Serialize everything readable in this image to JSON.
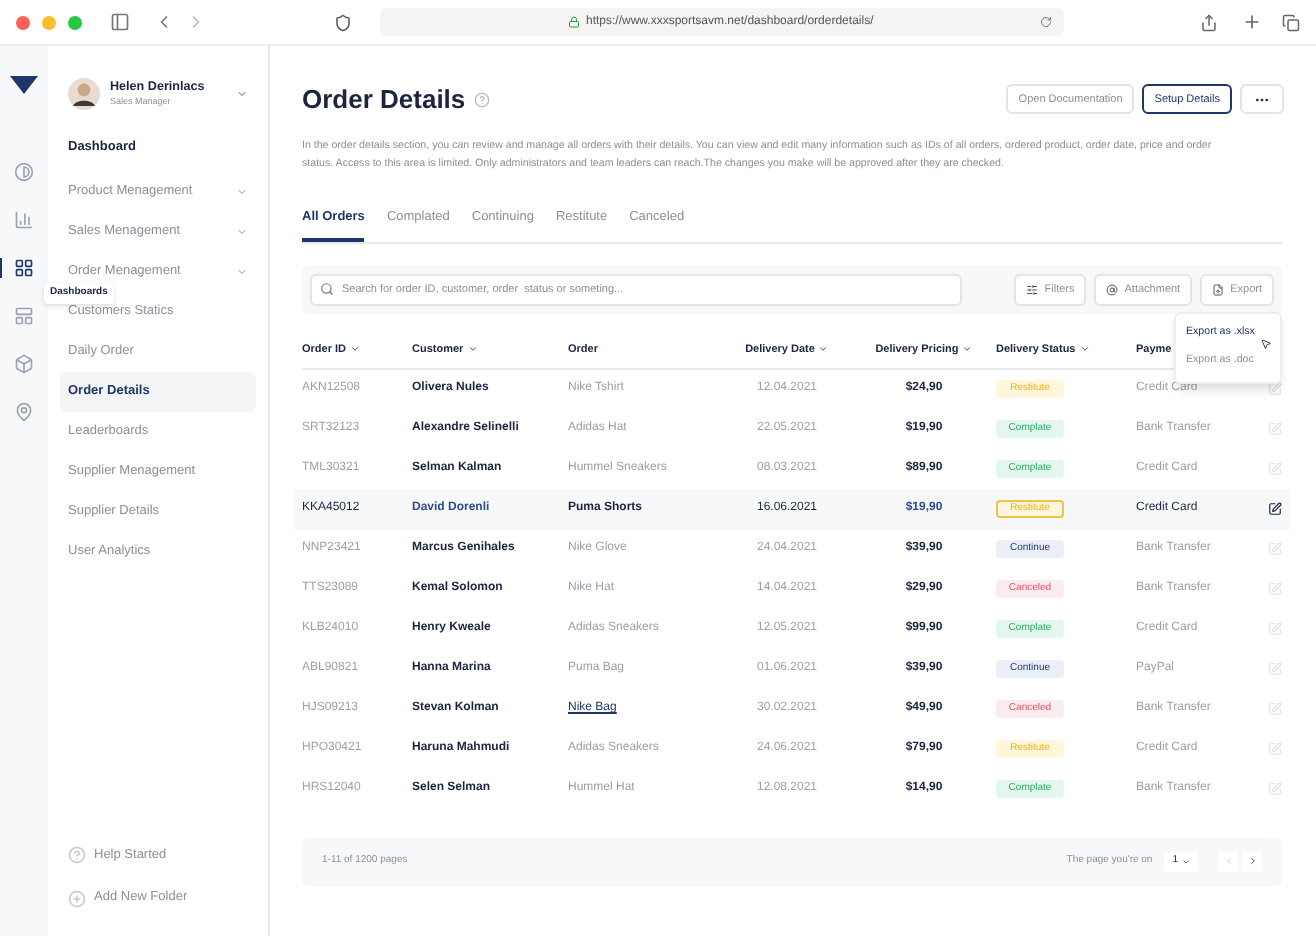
{
  "browser": {
    "url": "https://www.xxxsportsavm.net/dashboard/orderdetails/"
  },
  "rail": [
    {
      "selected": false
    },
    {
      "selected": false
    },
    {
      "selected": true
    },
    {
      "selected": false
    },
    {
      "selected": false
    },
    {
      "selected": false
    }
  ],
  "tooltip": "Dashboards",
  "profile": {
    "name": "Helen Derinlacs",
    "role": "Sales Manager"
  },
  "sidebar": {
    "heading": "Dashboard",
    "items": [
      {
        "label": "Product Menagement",
        "expandable": true,
        "selected": false
      },
      {
        "label": "Sales Menagement",
        "expandable": true,
        "selected": false
      },
      {
        "label": "Order Menagement",
        "expandable": true,
        "selected": false
      },
      {
        "label": "Customers Statics",
        "expandable": false,
        "selected": false
      },
      {
        "label": "Daily Order",
        "expandable": false,
        "selected": false
      },
      {
        "label": "Order Details",
        "expandable": false,
        "selected": true
      },
      {
        "label": "Leaderboards",
        "expandable": false,
        "selected": false
      },
      {
        "label": "Supplier Menagement",
        "expandable": false,
        "selected": false
      },
      {
        "label": "Supplier Details",
        "expandable": false,
        "selected": false
      },
      {
        "label": "User Analytics",
        "expandable": false,
        "selected": false
      }
    ],
    "footer": [
      {
        "label": "Help Started"
      },
      {
        "label": "Add New Folder"
      }
    ]
  },
  "page": {
    "title": "Order Details",
    "buttons": [
      {
        "label": "Open Documentation",
        "selected": false
      },
      {
        "label": "Setup Details",
        "selected": true
      }
    ],
    "description": "In the order details section, you can review and manage all orders with their details. You can view and edit many information such as IDs of all orders, ordered product, order date, price and order status. Access to this area is limited. Only administrators and team leaders can reach.The changes you make will be approved after they are checked."
  },
  "tabs": [
    {
      "label": "All Orders",
      "selected": true
    },
    {
      "label": "Complated",
      "selected": false
    },
    {
      "label": "Continuing",
      "selected": false
    },
    {
      "label": "Restitute",
      "selected": false
    },
    {
      "label": "Canceled",
      "selected": false
    }
  ],
  "search": {
    "placeholder": "Search for order ID, customer, order  status or someting..."
  },
  "toolbar": [
    {
      "label": "Filters"
    },
    {
      "label": "Attachment"
    },
    {
      "label": "Export"
    }
  ],
  "export_menu": [
    {
      "label": "Export as .xlsx",
      "selected": true
    },
    {
      "label": "Export as .doc",
      "selected": false
    }
  ],
  "table": {
    "columns": [
      {
        "label": "Order ID",
        "sortable": true
      },
      {
        "label": "Customer",
        "sortable": true
      },
      {
        "label": "Order",
        "sortable": false
      },
      {
        "label": "Delivery Date",
        "sortable": true
      },
      {
        "label": "Delivery Pricing",
        "sortable": true
      },
      {
        "label": "Delivery Status",
        "sortable": true
      },
      {
        "label": "Payme"
      }
    ],
    "rows": [
      {
        "id": "AKN12508",
        "customer": "Olivera Nules",
        "order": "Nike Tshirt",
        "date": "12.04.2021",
        "price": "$24,90",
        "status": {
          "label": "Restitute",
          "kind": "restitute"
        },
        "payment": "Credit Card",
        "selected": false,
        "link": false
      },
      {
        "id": "SRT32123",
        "customer": "Alexandre Selinelli",
        "order": "Adidas Hat",
        "date": "22.05.2021",
        "price": "$19,90",
        "status": {
          "label": "Complate",
          "kind": "complete"
        },
        "payment": "Bank Transfer",
        "selected": false,
        "link": false
      },
      {
        "id": "TML30321",
        "customer": "Selman Kalman",
        "order": "Hummel Sneakers",
        "date": "08.03.2021",
        "price": "$89,90",
        "status": {
          "label": "Complate",
          "kind": "complete"
        },
        "payment": "Credit Card",
        "selected": false,
        "link": false
      },
      {
        "id": "KKA45012",
        "customer": "David Dorenli",
        "order": "Puma Shorts",
        "date": "16.06.2021",
        "price": "$19,90",
        "status": {
          "label": "Restitute",
          "kind": "restitute"
        },
        "payment": "Credit Card",
        "selected": true,
        "link": false
      },
      {
        "id": "NNP23421",
        "customer": "Marcus Genihales",
        "order": "Nike Glove",
        "date": "24.04.2021",
        "price": "$39,90",
        "status": {
          "label": "Continue",
          "kind": "continue"
        },
        "payment": "Bank Transfer",
        "selected": false,
        "link": false
      },
      {
        "id": "TTS23089",
        "customer": "Kemal Solomon",
        "order": "Nike Hat",
        "date": "14.04.2021",
        "price": "$29,90",
        "status": {
          "label": "Canceled",
          "kind": "canceled"
        },
        "payment": "Bank Transfer",
        "selected": false,
        "link": false
      },
      {
        "id": "KLB24010",
        "customer": "Henry Kweale",
        "order": "Adidas Sneakers",
        "date": "12.05.2021",
        "price": "$99,90",
        "status": {
          "label": "Complate",
          "kind": "complete"
        },
        "payment": "Credit Card",
        "selected": false,
        "link": false
      },
      {
        "id": "ABL90821",
        "customer": "Hanna Marina",
        "order": "Puma Bag",
        "date": "01.06.2021",
        "price": "$39,90",
        "status": {
          "label": "Continue",
          "kind": "continue"
        },
        "payment": "PayPal",
        "selected": false,
        "link": false
      },
      {
        "id": "HJS09213",
        "customer": "Stevan Kolman",
        "order": "Nike Bag",
        "date": "30.02.2021",
        "price": "$49,90",
        "status": {
          "label": "Canceled",
          "kind": "canceled"
        },
        "payment": "Bank Transfer",
        "selected": false,
        "link": true
      },
      {
        "id": "HPO30421",
        "customer": "Haruna Mahmudi",
        "order": "Adidas Sneakers",
        "date": "24.06.2021",
        "price": "$79,90",
        "status": {
          "label": "Restitute",
          "kind": "restitute"
        },
        "payment": "Credit Card",
        "selected": false,
        "link": false
      },
      {
        "id": "HRS12040",
        "customer": "Selen Selman",
        "order": "Hummel Hat",
        "date": "12.08.2021",
        "price": "$14,90",
        "status": {
          "label": "Complate",
          "kind": "complete"
        },
        "payment": "Bank Transfer",
        "selected": false,
        "link": false
      }
    ]
  },
  "pagination": {
    "summary": "1-11 of 1200 pages",
    "page_label": "The page you're on",
    "page": "1"
  }
}
